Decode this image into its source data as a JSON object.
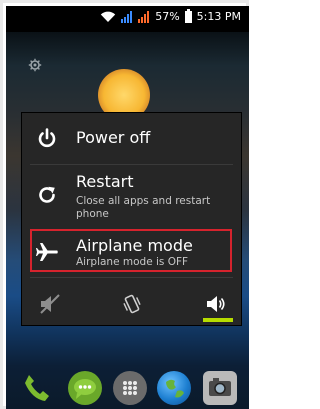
{
  "status_bar": {
    "battery": "57%",
    "time": "5:13 PM",
    "icons": [
      "wifi-icon",
      "signal-icon",
      "signal-icon",
      "battery-icon"
    ]
  },
  "home": {
    "icons": [
      "settings-gear-icon",
      "weather-sun-icon"
    ]
  },
  "power_menu": {
    "items": [
      {
        "icon": "power-icon",
        "title": "Power off"
      },
      {
        "icon": "restart-icon",
        "title": "Restart",
        "subtitle": "Close all apps and restart phone"
      },
      {
        "icon": "airplane-icon",
        "title": "Airplane mode",
        "subtitle": "Airplane mode is OFF"
      }
    ],
    "sound_modes": [
      {
        "icon": "silent-icon"
      },
      {
        "icon": "vibrate-icon"
      },
      {
        "icon": "sound-on-icon",
        "selected": true
      }
    ],
    "highlight_color": "#d6232d",
    "selected_indicator_color": "#b7dc00"
  },
  "dock": {
    "apps": [
      {
        "icon": "phone-icon"
      },
      {
        "icon": "messaging-icon"
      },
      {
        "icon": "app-drawer-icon"
      },
      {
        "icon": "browser-globe-icon"
      },
      {
        "icon": "camera-icon"
      }
    ]
  }
}
